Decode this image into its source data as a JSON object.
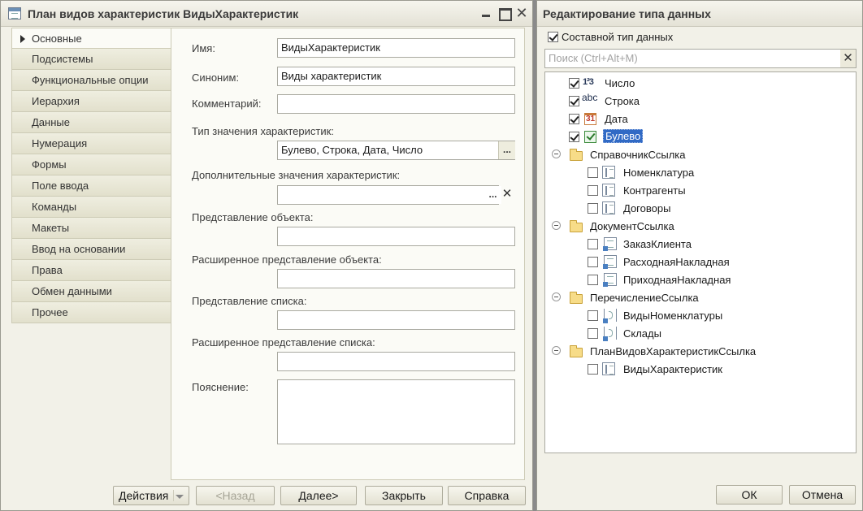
{
  "left_window": {
    "title": "План видов характеристик ВидыХарактеристик",
    "tabs": [
      {
        "label": "Основные"
      },
      {
        "label": "Подсистемы"
      },
      {
        "label": "Функциональные опции"
      },
      {
        "label": "Иерархия"
      },
      {
        "label": "Данные"
      },
      {
        "label": "Нумерация"
      },
      {
        "label": "Формы"
      },
      {
        "label": "Поле ввода"
      },
      {
        "label": "Команды"
      },
      {
        "label": "Макеты"
      },
      {
        "label": "Ввод на основании"
      },
      {
        "label": "Права"
      },
      {
        "label": "Обмен данными"
      },
      {
        "label": "Прочее"
      }
    ],
    "fields": {
      "name_label": "Имя:",
      "name_value": "ВидыХарактеристик",
      "synonym_label": "Синоним:",
      "synonym_value": "Виды характеристик",
      "comment_label": "Комментарий:",
      "comment_value": "",
      "value_type_label": "Тип значения характеристик:",
      "value_type_value": "Булево, Строка, Дата, Число",
      "extra_values_label": "Дополнительные значения характеристик:",
      "extra_values_value": "",
      "object_repr_label": "Представление объекта:",
      "object_repr_value": "",
      "ext_object_repr_label": "Расширенное представление объекта:",
      "ext_object_repr_value": "",
      "list_repr_label": "Представление списка:",
      "list_repr_value": "",
      "ext_list_repr_label": "Расширенное представление списка:",
      "ext_list_repr_value": "",
      "explanation_label": "Пояснение:",
      "explanation_value": ""
    },
    "buttons": {
      "actions": "Действия",
      "back": "<Назад",
      "next": "Далее>",
      "close": "Закрыть",
      "help": "Справка"
    }
  },
  "right_window": {
    "title": "Редактирование типа данных",
    "composite_label": "Составной тип данных",
    "composite_checked": true,
    "search_placeholder": "Поиск (Ctrl+Alt+M)",
    "primitives": [
      {
        "label": "Число",
        "checked": true,
        "icon": "number-icon",
        "glyph": "1²3"
      },
      {
        "label": "Строка",
        "checked": true,
        "icon": "string-icon",
        "glyph": "abc"
      },
      {
        "label": "Дата",
        "checked": true,
        "icon": "date-icon",
        "glyph": "31"
      },
      {
        "label": "Булево",
        "checked": true,
        "icon": "boolean-icon",
        "selected": true
      }
    ],
    "groups": [
      {
        "label": "СправочникСсылка",
        "icon": "catalog-icon",
        "items": [
          {
            "label": "Номенклатура",
            "checked": false
          },
          {
            "label": "Контрагенты",
            "checked": false
          },
          {
            "label": "Договоры",
            "checked": false
          }
        ]
      },
      {
        "label": "ДокументСсылка",
        "icon": "document-icon",
        "items": [
          {
            "label": "ЗаказКлиента",
            "checked": false
          },
          {
            "label": "РасходнаяНакладная",
            "checked": false
          },
          {
            "label": "ПриходнаяНакладная",
            "checked": false
          }
        ]
      },
      {
        "label": "ПеречислениеСсылка",
        "icon": "enum-icon",
        "items": [
          {
            "label": "ВидыНоменклатуры",
            "checked": false
          },
          {
            "label": "Склады",
            "checked": false
          }
        ]
      },
      {
        "label": "ПланВидовХарактеристикСсылка",
        "icon": "characteristic-icon",
        "items": [
          {
            "label": "ВидыХарактеристик",
            "checked": false
          }
        ]
      }
    ],
    "buttons": {
      "ok": "ОК",
      "cancel": "Отмена"
    }
  }
}
